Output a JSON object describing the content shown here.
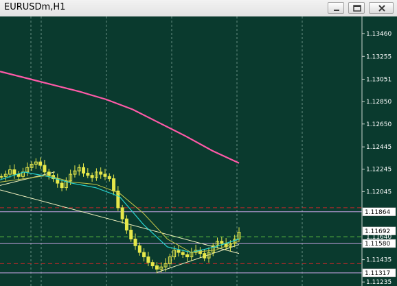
{
  "window": {
    "title": "EURUSDm,H1"
  },
  "icons": {
    "minimize": "minimize-icon",
    "maximize": "maximize-icon",
    "close": "close-icon"
  },
  "colors": {
    "background": "#0a3a2e",
    "grid": "#8fb1a5",
    "candles": "#e6e84a",
    "ma_long": "#ff5aa8",
    "ma_short": "#27d3d0",
    "ma_mid": "#c8c84a",
    "level_line": "#c9a6e8",
    "dashed_red": "#c02828",
    "dashed_green": "#5fbf3f",
    "axis_text": "#ffffff"
  },
  "chart_data": {
    "type": "candlestick",
    "symbol": "EURUSDm",
    "timeframe": "H1",
    "price_axis_ticks": [
      "1.13460",
      "1.13255",
      "1.13051",
      "1.12850",
      "1.12650",
      "1.12445",
      "1.12245",
      "1.12045",
      "1.11864",
      "1.11692",
      "1.11640",
      "1.11580",
      "1.11435",
      "1.11317",
      "1.11235"
    ],
    "price_markers": [
      {
        "label": "1.11864",
        "value": 1.11864,
        "style": "box"
      },
      {
        "label": "1.11692",
        "value": 1.11692,
        "style": "box"
      },
      {
        "label": "1.11640",
        "value": 1.1164,
        "style": "text"
      },
      {
        "label": "1.11580",
        "value": 1.1158,
        "style": "box"
      },
      {
        "label": "1.11317",
        "value": 1.11317,
        "style": "box"
      }
    ],
    "horizontal_levels": [
      {
        "value": 1.11864,
        "style": "solid",
        "color": "#c9a6e8"
      },
      {
        "value": 1.1158,
        "style": "solid",
        "color": "#c9a6e8"
      },
      {
        "value": 1.11317,
        "style": "solid",
        "color": "#c9a6e8"
      },
      {
        "value": 1.119,
        "style": "dashed",
        "color": "#c02828"
      },
      {
        "value": 1.1164,
        "style": "dashed",
        "color": "#5fbf3f"
      },
      {
        "value": 1.114,
        "style": "dashed",
        "color": "#c02828"
      }
    ],
    "ma_long": [
      1.1312,
      1.1306,
      1.13,
      1.1294,
      1.1287,
      1.1278,
      1.1266,
      1.1254,
      1.1241,
      1.123
    ],
    "ma_short": [
      1.1215,
      1.1222,
      1.1218,
      1.1212,
      1.1208,
      1.12,
      1.1175,
      1.1155,
      1.115,
      1.1155,
      1.1162
    ],
    "ma_mid": [
      1.1213,
      1.1216,
      1.1219,
      1.1213,
      1.1211,
      1.1203,
      1.1185,
      1.1162,
      1.115,
      1.1152,
      1.116
    ],
    "trendlines": [
      {
        "from": 1.1206,
        "to": 1.1149
      },
      {
        "from": 1.1132,
        "to": 1.1157
      },
      {
        "from": 1.121,
        "to": 1.1222
      }
    ],
    "close_series": [
      1.1218,
      1.122,
      1.1224,
      1.122,
      1.1218,
      1.1222,
      1.1226,
      1.1229,
      1.1231,
      1.1228,
      1.1222,
      1.1219,
      1.1216,
      1.1212,
      1.1208,
      1.1214,
      1.122,
      1.1223,
      1.1226,
      1.1221,
      1.1219,
      1.1217,
      1.1222,
      1.122,
      1.1218,
      1.1216,
      1.1205,
      1.119,
      1.118,
      1.117,
      1.1162,
      1.1156,
      1.115,
      1.1146,
      1.1141,
      1.1138,
      1.1135,
      1.1137,
      1.114,
      1.1146,
      1.1152,
      1.115,
      1.1148,
      1.1146,
      1.115,
      1.1152,
      1.1149,
      1.1145,
      1.115,
      1.1156,
      1.116,
      1.1158,
      1.1155,
      1.1158,
      1.1162,
      1.1168
    ]
  }
}
